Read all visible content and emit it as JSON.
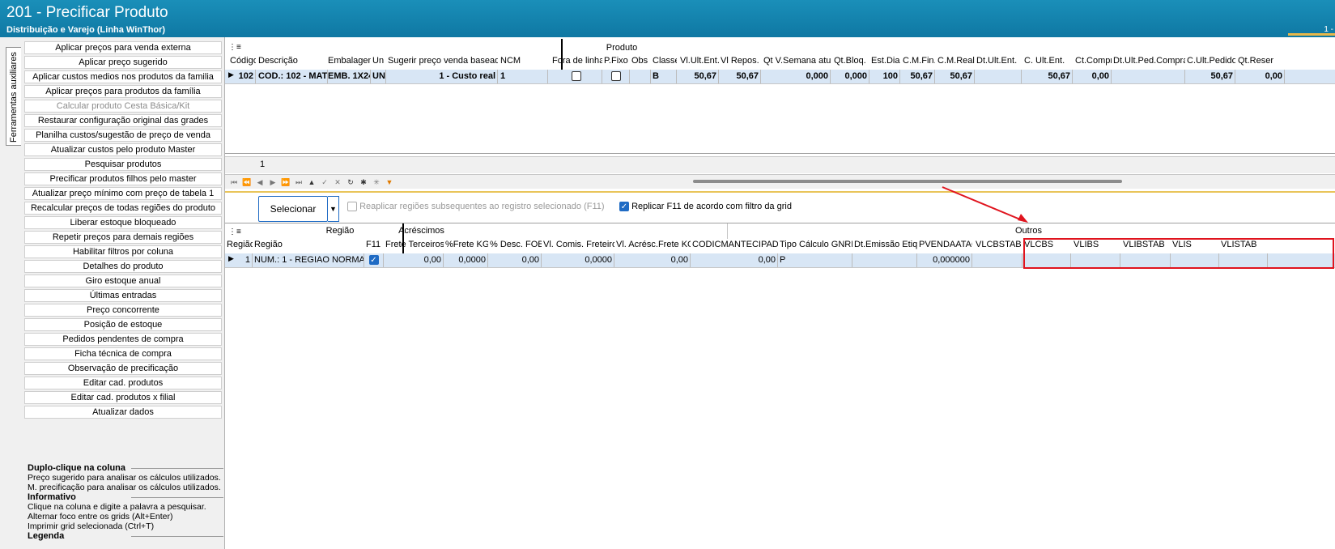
{
  "window": {
    "title": "201 - Precificar Produto",
    "subtitle": "Distribuição e Varejo (Linha WinThor)",
    "page_indicator": "1 -"
  },
  "sidetab": {
    "label": "Ferramentas auxiliares"
  },
  "actions": [
    {
      "label": "Aplicar preços para venda externa",
      "enabled": true
    },
    {
      "label": "Aplicar preço sugerido",
      "enabled": true
    },
    {
      "label": "Aplicar custos medios nos produtos da familia",
      "enabled": true
    },
    {
      "label": "Aplicar preços para produtos da família",
      "enabled": true
    },
    {
      "label": "Calcular produto Cesta Básica/Kit",
      "enabled": false
    },
    {
      "label": "Restaurar configuração original das grades",
      "enabled": true
    },
    {
      "label": "Planilha custos/sugestão de preço de venda",
      "enabled": true
    },
    {
      "label": "Atualizar custos pelo produto Master",
      "enabled": true
    },
    {
      "label": "Pesquisar produtos",
      "enabled": true
    },
    {
      "label": "Precificar produtos filhos pelo master",
      "enabled": true
    },
    {
      "label": "Atualizar preço mínimo com preço de tabela 1",
      "enabled": true
    },
    {
      "label": "Recalcular preços de todas regiões do produto",
      "enabled": true
    },
    {
      "label": "Liberar estoque bloqueado",
      "enabled": true
    },
    {
      "label": "Repetir preços para demais regiões",
      "enabled": true
    },
    {
      "label": "Habilitar filtros por coluna",
      "enabled": true
    },
    {
      "label": "Detalhes do produto",
      "enabled": true
    },
    {
      "label": "Giro estoque anual",
      "enabled": true
    },
    {
      "label": "Últimas entradas",
      "enabled": true
    },
    {
      "label": "Preço concorrente",
      "enabled": true
    },
    {
      "label": "Posição de estoque",
      "enabled": true
    },
    {
      "label": "Pedidos pendentes de compra",
      "enabled": true
    },
    {
      "label": "Ficha técnica de compra",
      "enabled": true
    },
    {
      "label": "Observação de precificação",
      "enabled": true
    },
    {
      "label": "Editar cad. produtos",
      "enabled": true
    },
    {
      "label": "Editar cad. produtos x filial",
      "enabled": true
    },
    {
      "label": "Atualizar dados",
      "enabled": true
    }
  ],
  "info": {
    "duplo_title": "Duplo-clique na coluna",
    "duplo_lines": [
      "Preço sugerido para analisar os cálculos utilizados.",
      "M. precificação para analisar os cálculos utilizados."
    ],
    "informativo_title": "Informativo",
    "informativo_lines": [
      "Clique na coluna e digite a palavra a pesquisar.",
      "Alternar foco entre os grids (Alt+Enter)",
      "Imprimir grid selecionada (Ctrl+T)"
    ],
    "legenda_title": "Legenda"
  },
  "product_grid": {
    "group_label": "Produto",
    "columns": [
      "Código",
      "Descrição",
      "Embalagem",
      "Un",
      "Sugerir preço venda baseado",
      "NCM",
      "Fora de linha",
      "P.Fixo",
      "Obs",
      "Classe",
      "Vl.Ult.Ent.",
      "Vl Repos.",
      "Qt V.Semana atual",
      "Qt.Bloq.",
      "Est.Dia",
      "C.M.Fin.",
      "C.M.Real",
      "Dt.Ult.Ent.",
      "C. Ult.Ent.",
      "Ct.Compra",
      "Dt.Ult.Ped.Compra",
      "C.Ult.Pedido",
      "Qt.Reser"
    ],
    "row": {
      "codigo": "102",
      "descricao": "COD.: 102 - MAT",
      "embalagem": "EMB. 1X24",
      "un": "UN",
      "sugerir": "1 - Custo real",
      "ncm": "1",
      "fora_de_linha": false,
      "p_fixo": false,
      "obs": "",
      "classe": "B",
      "vl_ult_ent": "50,67",
      "vl_repos": "50,67",
      "qt_semana": "0,000",
      "qt_bloq": "0,000",
      "est_dia": "100",
      "cm_fin": "50,67",
      "cm_real": "50,67",
      "dt_ult_ent": "",
      "c_ult_ent": "50,67",
      "ct_compra": "0,00",
      "dt_ult_ped": "",
      "c_ult_pedido": "50,67",
      "qt_reser": "0,00"
    },
    "footer_count": "1"
  },
  "controls": {
    "select_button": "Selecionar",
    "reapply_label": "Reaplicar regiões subsequentes ao registro selecionado (F11)",
    "reapply_checked": false,
    "replicar_label": "Replicar F11 de acordo com filtro da grid",
    "replicar_checked": true
  },
  "region_grid": {
    "group_regiao": "Região",
    "group_acrescimos": "Acréscimos",
    "group_outros": "Outros",
    "columns": [
      "Região",
      "Região",
      "F11",
      "Frete Terceiros",
      "%Frete KG",
      "% Desc. FOB",
      "Vl. Comis. Freteiro",
      "Vl. Acrésc.Frete KG",
      "CODICMANTECIPADO",
      "Tipo Cálculo GNRE?",
      "Dt.Emissão Etiq.",
      "PVENDAATAC",
      "VLCBSTAB",
      "VLCBS",
      "VLIBS",
      "VLIBSTAB",
      "VLIS",
      "VLISTAB"
    ],
    "row": {
      "regiao_num": "1",
      "regiao_nome": "NUM.: 1 - REGIAO NORMAL",
      "f11": true,
      "frete_terceiros": "0,00",
      "frete_kg": "0,0000",
      "desc_fob": "0,00",
      "comis_freteiro": "0,0000",
      "acresc_frete_kg": "0,00",
      "codicm": "0,00",
      "tipo_gnre": "P",
      "dt_emissao": "",
      "pvendaatac": "0,000000"
    }
  },
  "annotation": {
    "color": "#e0141e"
  }
}
